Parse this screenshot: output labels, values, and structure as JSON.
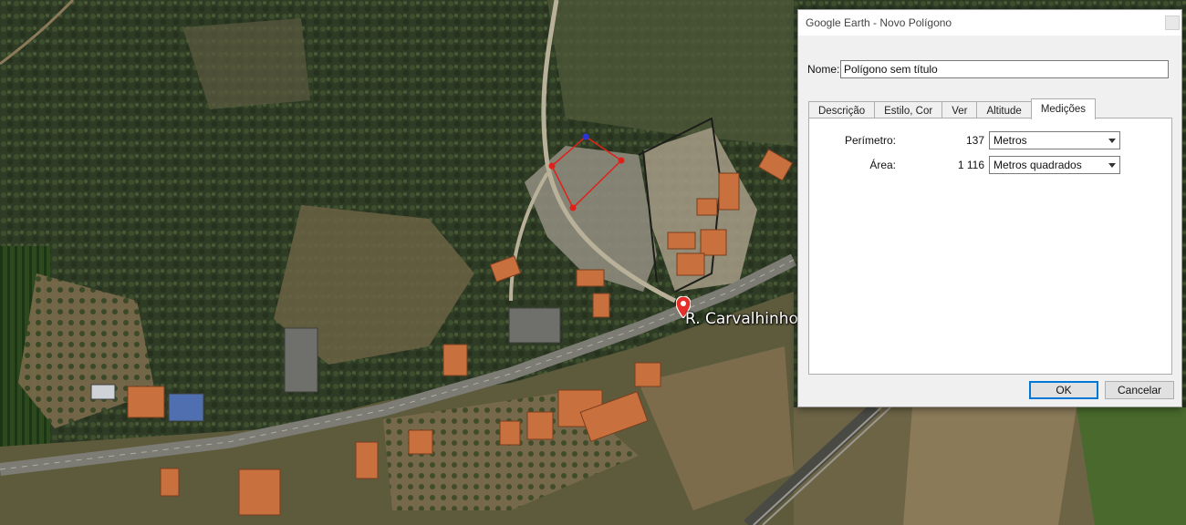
{
  "map": {
    "street_label": "R. Carvalhinho",
    "polygon_color": "#e0201a",
    "active_vertex_color": "#2a35d8"
  },
  "dialog": {
    "title": "Google Earth - Novo Polígono",
    "name_label": "Nome:",
    "name_value": "Polígono sem título",
    "tabs": [
      {
        "label": "Descrição",
        "active": false
      },
      {
        "label": "Estilo, Cor",
        "active": false
      },
      {
        "label": "Ver",
        "active": false
      },
      {
        "label": "Altitude",
        "active": false
      },
      {
        "label": "Medições",
        "active": true
      }
    ],
    "measurements": {
      "perimeter_label": "Perímetro:",
      "perimeter_value": "137",
      "perimeter_unit": "Metros",
      "area_label": "Área:",
      "area_value": "1 116",
      "area_unit": "Metros quadrados"
    },
    "ok_label": "OK",
    "cancel_label": "Cancelar"
  }
}
